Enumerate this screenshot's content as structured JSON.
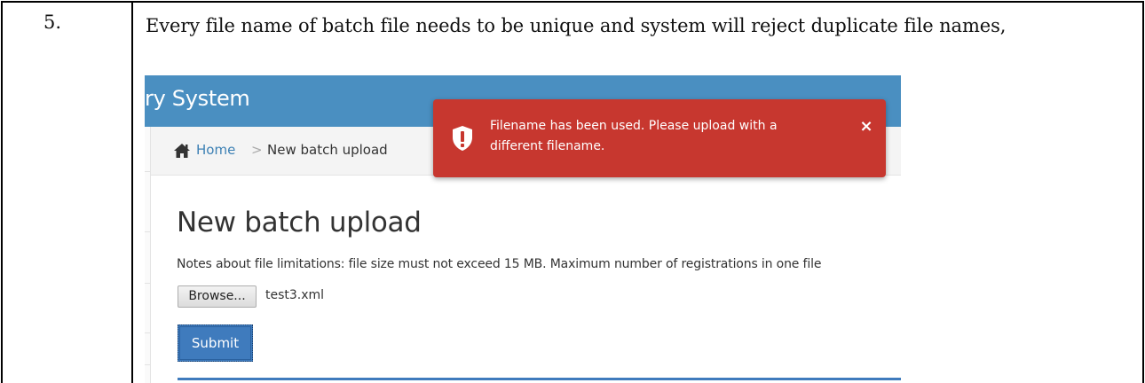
{
  "step": {
    "number": "5.",
    "description": "Every file name of batch file needs to be unique and system will reject duplicate file names,"
  },
  "screenshot": {
    "app_title": "ry System",
    "breadcrumb": {
      "home": "Home",
      "separator": ">",
      "current": "New batch upload",
      "home_icon": "home-icon"
    },
    "page_title": "New batch upload",
    "notes": "Notes about file limitations: file size must not exceed 15 MB. Maximum number of registrations in one file",
    "file_input": {
      "browse_label": "Browse...",
      "selected_file": "test3.xml"
    },
    "submit_label": "Submit",
    "alert": {
      "message": "Filename has been used. Please upload with a different filename.",
      "close_symbol": "×",
      "icon": "shield-exclamation-icon"
    },
    "colors": {
      "header": "#4a8fc1",
      "alert": "#c7372f",
      "primary_button": "#3f7bbd",
      "link": "#3c80b4"
    }
  }
}
